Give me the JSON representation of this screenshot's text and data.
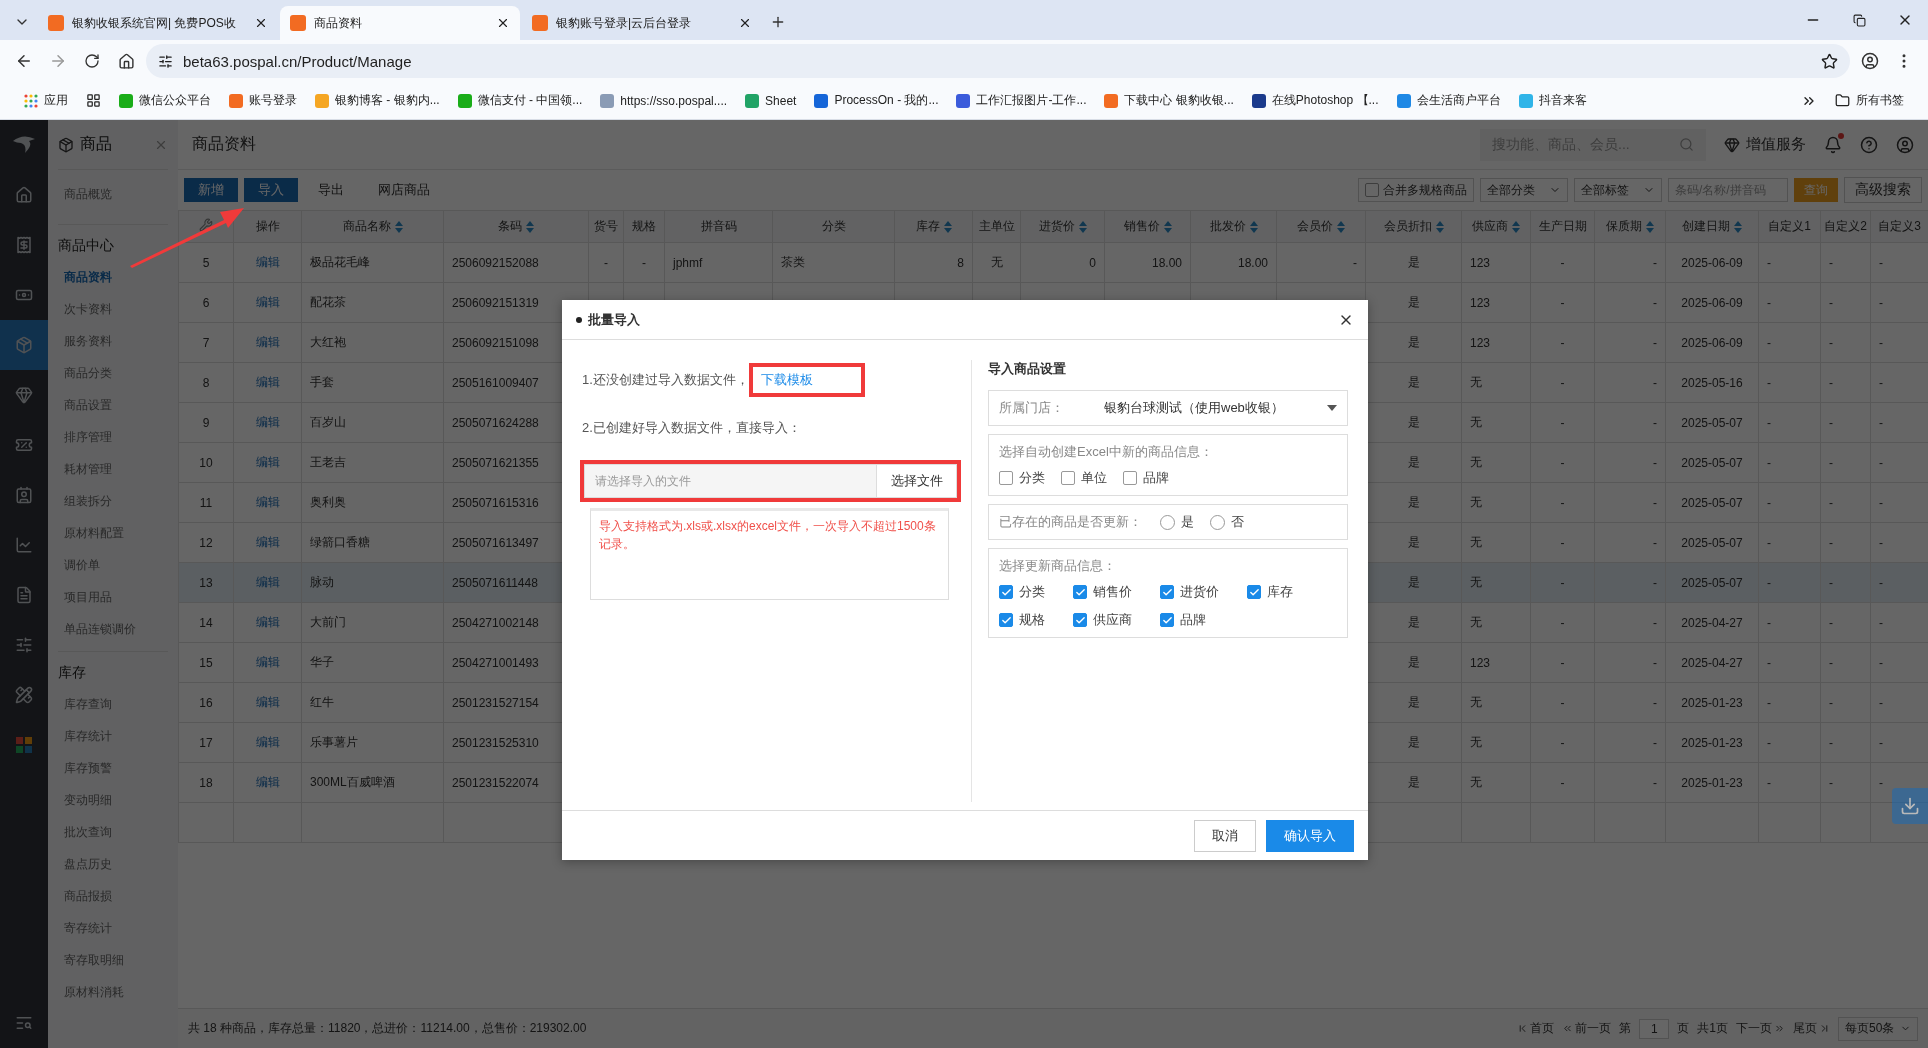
{
  "browser": {
    "tabs": [
      {
        "title": "银豹收银系统官网| 免费POS收",
        "selected": false
      },
      {
        "title": "商品资料",
        "selected": true
      },
      {
        "title": "银豹账号登录|云后台登录",
        "selected": false
      }
    ],
    "address": "beta63.pospal.cn/Product/Manage",
    "apps_label": "应用",
    "bookmarks": [
      {
        "label": "微信公众平台",
        "color": "#1aad19"
      },
      {
        "label": "账号登录",
        "color": "#f26b22"
      },
      {
        "label": "银豹博客 - 银豹内...",
        "color": "#f5a623"
      },
      {
        "label": "微信支付 - 中国领...",
        "color": "#1aad19"
      },
      {
        "label": "https://sso.pospal....",
        "color": "#8a9bb5"
      },
      {
        "label": "Sheet",
        "color": "#21a366"
      },
      {
        "label": "ProcessOn - 我的...",
        "color": "#1565d8"
      },
      {
        "label": "工作汇报图片-工作...",
        "color": "#3b5bdb"
      },
      {
        "label": "下载中心 银豹收银...",
        "color": "#f26b22"
      },
      {
        "label": "在线Photoshop 【...",
        "color": "#1b3a8c"
      },
      {
        "label": "会生活商户平台",
        "color": "#1e88e5"
      },
      {
        "label": "抖音来客",
        "color": "#2fb4e8"
      }
    ],
    "all_bookmarks": "所有书签"
  },
  "rail": [
    {
      "selected": false
    },
    {
      "selected": false
    },
    {
      "selected": false
    },
    {
      "selected": true
    },
    {
      "selected": false
    },
    {
      "selected": false
    },
    {
      "selected": false
    },
    {
      "selected": false
    },
    {
      "selected": false
    },
    {
      "selected": false
    },
    {
      "selected": false
    }
  ],
  "sidebar": {
    "title": "商品",
    "items": [
      {
        "label": "商品概览",
        "selected": false
      }
    ],
    "sections": [
      {
        "title": "商品中心",
        "items": [
          {
            "label": "商品资料",
            "selected": true
          },
          {
            "label": "次卡资料",
            "selected": false
          },
          {
            "label": "服务资料",
            "selected": false
          },
          {
            "label": "商品分类",
            "selected": false
          },
          {
            "label": "商品设置",
            "selected": false
          },
          {
            "label": "排序管理",
            "selected": false
          },
          {
            "label": "耗材管理",
            "selected": false
          },
          {
            "label": "组装拆分",
            "selected": false
          },
          {
            "label": "原材料配置",
            "selected": false
          },
          {
            "label": "调价单",
            "selected": false
          },
          {
            "label": "项目用品",
            "selected": false
          },
          {
            "label": "单品连锁调价",
            "selected": false
          }
        ]
      },
      {
        "title": "库存",
        "items": [
          {
            "label": "库存查询",
            "selected": false
          },
          {
            "label": "库存统计",
            "selected": false
          },
          {
            "label": "库存预警",
            "selected": false
          },
          {
            "label": "变动明细",
            "selected": false
          },
          {
            "label": "批次查询",
            "selected": false
          },
          {
            "label": "盘点历史",
            "selected": false
          },
          {
            "label": "商品报损",
            "selected": false
          },
          {
            "label": "寄存统计",
            "selected": false
          },
          {
            "label": "寄存取明细",
            "selected": false
          },
          {
            "label": "原材料消耗",
            "selected": false
          }
        ]
      }
    ]
  },
  "header": {
    "title": "商品资料",
    "search_placeholder": "搜功能、商品、会员...",
    "value_service": "增值服务",
    "has_notification": true
  },
  "toolbar": {
    "actions": [
      {
        "label": "新增",
        "kind": "primary"
      },
      {
        "label": "导入",
        "kind": "primary"
      },
      {
        "label": "导出",
        "kind": "link"
      },
      {
        "label": "网店商品",
        "kind": "link"
      }
    ],
    "merge_label": "合并多规格商品",
    "merge_checked": false,
    "category_filter": "全部分类",
    "tag_filter": "全部标签",
    "search_placeholder": "条码/名称/拼音码",
    "query": "查询",
    "advanced": "高级搜索"
  },
  "table": {
    "columns": [
      {
        "sortable": false
      },
      {
        "label": "操作",
        "sortable": false
      },
      {
        "label": "商品名称",
        "sortable": true
      },
      {
        "label": "条码",
        "sortable": true
      },
      {
        "label": "货号",
        "sortable": false
      },
      {
        "label": "规格",
        "sortable": false
      },
      {
        "label": "拼音码",
        "sortable": false
      },
      {
        "label": "分类",
        "sortable": false
      },
      {
        "label": "库存",
        "sortable": true
      },
      {
        "label": "主单位",
        "sortable": false
      },
      {
        "label": "进货价",
        "sortable": true
      },
      {
        "label": "销售价",
        "sortable": true
      },
      {
        "label": "批发价",
        "sortable": true
      },
      {
        "label": "会员价",
        "sortable": true
      },
      {
        "label": "会员折扣",
        "sortable": true
      },
      {
        "label": "供应商",
        "sortable": true
      },
      {
        "label": "生产日期",
        "sortable": false
      },
      {
        "label": "保质期",
        "sortable": true
      },
      {
        "label": "创建日期",
        "sortable": true
      },
      {
        "label": "自定义1",
        "sortable": false
      },
      {
        "label": "自定义2",
        "sortable": false
      },
      {
        "label": "自定义3",
        "sortable": false
      }
    ],
    "rows": [
      {
        "no": "5",
        "action": "编辑",
        "name": "极品花毛峰",
        "barcode": "2506092152088",
        "middle": [
          "-",
          "-",
          "jphmf",
          "茶类",
          "8",
          "无",
          "0",
          "18.00",
          "18.00",
          "-"
        ],
        "rest": [
          "是",
          "123",
          "-",
          "-",
          "2025-06-09",
          "-",
          "-",
          "-"
        ],
        "selected": false
      },
      {
        "no": "6",
        "action": "编辑",
        "name": "配花茶",
        "barcode": "2506092151319",
        "rest": [
          "是",
          "123",
          "-",
          "-",
          "2025-06-09",
          "-",
          "-",
          "-"
        ],
        "selected": false
      },
      {
        "no": "7",
        "action": "编辑",
        "name": "大红袍",
        "barcode": "2506092151098",
        "rest": [
          "是",
          "123",
          "-",
          "-",
          "2025-06-09",
          "-",
          "-",
          "-"
        ],
        "selected": false
      },
      {
        "no": "8",
        "action": "编辑",
        "name": "手套",
        "barcode": "2505161009407",
        "rest": [
          "是",
          "无",
          "-",
          "-",
          "2025-05-16",
          "-",
          "-",
          "-"
        ],
        "selected": false
      },
      {
        "no": "9",
        "action": "编辑",
        "name": "百岁山",
        "barcode": "2505071624288",
        "rest": [
          "是",
          "无",
          "-",
          "-",
          "2025-05-07",
          "-",
          "-",
          "-"
        ],
        "selected": false
      },
      {
        "no": "10",
        "action": "编辑",
        "name": "王老吉",
        "barcode": "2505071621355",
        "rest": [
          "是",
          "无",
          "-",
          "-",
          "2025-05-07",
          "-",
          "-",
          "-"
        ],
        "selected": false
      },
      {
        "no": "11",
        "action": "编辑",
        "name": "奥利奥",
        "barcode": "2505071615316",
        "rest": [
          "是",
          "无",
          "-",
          "-",
          "2025-05-07",
          "-",
          "-",
          "-"
        ],
        "selected": false
      },
      {
        "no": "12",
        "action": "编辑",
        "name": "绿箭口香糖",
        "barcode": "2505071613497",
        "rest": [
          "是",
          "无",
          "-",
          "-",
          "2025-05-07",
          "-",
          "-",
          "-"
        ],
        "selected": false
      },
      {
        "no": "13",
        "action": "编辑",
        "name": "脉动",
        "barcode": "2505071611448",
        "rest": [
          "是",
          "无",
          "-",
          "-",
          "2025-05-07",
          "-",
          "-",
          "-"
        ],
        "selected": true
      },
      {
        "no": "14",
        "action": "编辑",
        "name": "大前门",
        "barcode": "2504271002148",
        "rest": [
          "是",
          "无",
          "-",
          "-",
          "2025-04-27",
          "-",
          "-",
          "-"
        ],
        "selected": false
      },
      {
        "no": "15",
        "action": "编辑",
        "name": "华子",
        "barcode": "2504271001493",
        "rest": [
          "是",
          "123",
          "-",
          "-",
          "2025-04-27",
          "-",
          "-",
          "-"
        ],
        "selected": false
      },
      {
        "no": "16",
        "action": "编辑",
        "name": "红牛",
        "barcode": "2501231527154",
        "rest": [
          "是",
          "无",
          "-",
          "-",
          "2025-01-23",
          "-",
          "-",
          "-"
        ],
        "selected": false
      },
      {
        "no": "17",
        "action": "编辑",
        "name": "乐事薯片",
        "barcode": "2501231525310",
        "rest": [
          "是",
          "无",
          "-",
          "-",
          "2025-01-23",
          "-",
          "-",
          "-"
        ],
        "selected": false
      },
      {
        "no": "18",
        "action": "编辑",
        "name": "300ML百威啤酒",
        "barcode": "2501231522074",
        "rest": [
          "是",
          "无",
          "-",
          "-",
          "2025-01-23",
          "-",
          "-",
          "-"
        ],
        "selected": false
      }
    ]
  },
  "footer": {
    "summary": "共 18 种商品，库存总量：11820，总进价：11214.00，总售价：219302.00",
    "first": "首页",
    "prev": "前一页",
    "page_prefix": "第",
    "page": "1",
    "page_suffix": "页",
    "total_pages": "共1页",
    "next": "下一页",
    "last": "尾页",
    "page_size": "每页50条"
  },
  "dialog": {
    "title": "批量导入",
    "step1": "1.还没创建过导入数据文件，",
    "download_link": "下载模板",
    "step2": "2.已创建好导入数据文件，直接导入：",
    "file_placeholder": "请选择导入的文件",
    "choose_file": "选择文件",
    "note": "导入支持格式为.xls或.xlsx的excel文件，一次导入不超过1500条记录。",
    "settings_title": "导入商品设置",
    "store_label": "所属门店：",
    "store_value": "银豹台球测试（使用web收银）",
    "create_title": "选择自动创建Excel中新的商品信息：",
    "create_options": [
      {
        "label": "分类",
        "checked": false
      },
      {
        "label": "单位",
        "checked": false
      },
      {
        "label": "品牌",
        "checked": false
      }
    ],
    "update_title": "已存在的商品是否更新：",
    "update_options": [
      {
        "label": "是",
        "selected": false
      },
      {
        "label": "否",
        "selected": false
      }
    ],
    "fields_title": "选择更新商品信息：",
    "fields": [
      {
        "label": "分类",
        "checked": true
      },
      {
        "label": "销售价",
        "checked": true
      },
      {
        "label": "进货价",
        "checked": true
      },
      {
        "label": "库存",
        "checked": true
      },
      {
        "label": "规格",
        "checked": true
      },
      {
        "label": "供应商",
        "checked": true
      },
      {
        "label": "品牌",
        "checked": true
      }
    ],
    "cancel": "取消",
    "confirm": "确认导入"
  }
}
